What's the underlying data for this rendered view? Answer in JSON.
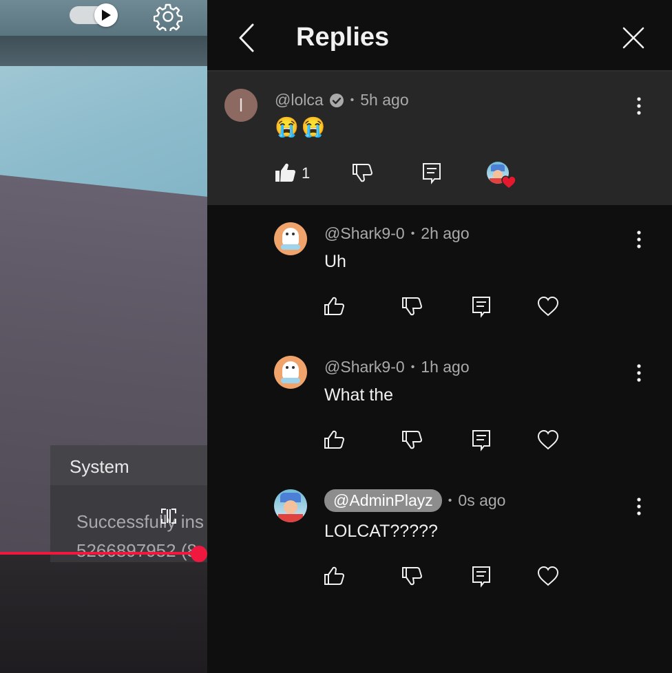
{
  "video": {
    "toast_title": "System",
    "toast_message_line1": "Successfully ins",
    "toast_message_line2": "5266897952 (8"
  },
  "panel": {
    "title": "Replies"
  },
  "parent_comment": {
    "avatar_letter": "l",
    "author": "@lolca",
    "time": "5h ago",
    "text": "😭😭",
    "like_count": "1"
  },
  "replies": [
    {
      "author": "@Shark9-0",
      "time": "2h ago",
      "text": "Uh"
    },
    {
      "author": "@Shark9-0",
      "time": "1h ago",
      "text": "What the"
    },
    {
      "author": "@AdminPlayz",
      "time": "0s ago",
      "text": "LOLCAT?????"
    }
  ],
  "colors": {
    "accent_red": "#f0183f",
    "panel_bg": "#0f0f0f",
    "highlight_bg": "#272727",
    "meta_text": "#aaaaaa"
  }
}
